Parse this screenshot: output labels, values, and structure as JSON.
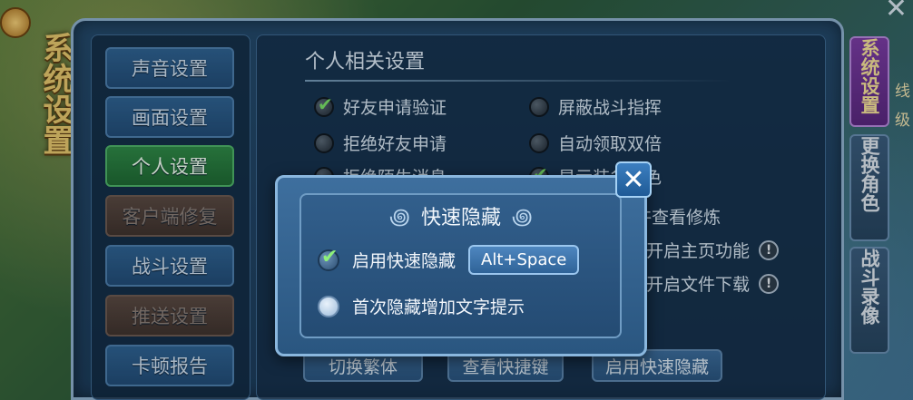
{
  "left_title": "系统设置",
  "nav": {
    "items": [
      {
        "label": "声音设置",
        "state": "normal"
      },
      {
        "label": "画面设置",
        "state": "normal"
      },
      {
        "label": "个人设置",
        "state": "active"
      },
      {
        "label": "客户端修复",
        "state": "dim"
      },
      {
        "label": "战斗设置",
        "state": "normal"
      },
      {
        "label": "推送设置",
        "state": "dim"
      },
      {
        "label": "卡顿报告",
        "state": "normal"
      }
    ]
  },
  "content": {
    "section_title": "个人相关设置",
    "options_left": [
      {
        "label": "好友申请验证",
        "checked": true
      },
      {
        "label": "拒绝好友申请",
        "checked": false
      },
      {
        "label": "拒绝陌生消息",
        "checked": false
      }
    ],
    "options_right": [
      {
        "label": "屏蔽战斗指挥",
        "checked": false
      },
      {
        "label": "自动领取双倍",
        "checked": false
      },
      {
        "label": "显示装备角色",
        "checked": true
      }
    ],
    "right_partial": [
      {
        "label": "允许查看修炼"
      },
      {
        "label": "开启主页功能"
      },
      {
        "label": "开启文件下载"
      }
    ],
    "bottom_buttons": [
      "切换繁体",
      "查看快捷键",
      "启用快速隐藏"
    ]
  },
  "side_tabs": [
    {
      "label": "系统设置",
      "state": "active"
    },
    {
      "label": "更换角色",
      "state": "normal"
    },
    {
      "label": "战斗录像",
      "state": "normal"
    }
  ],
  "edge_text": [
    "线",
    "级"
  ],
  "dialog": {
    "title": "快速隐藏",
    "close_symbol": "✕",
    "enable_label": "启用快速隐藏",
    "enable_checked": true,
    "hotkey": "Alt+Space",
    "tip_label": "首次隐藏增加文字提示",
    "tip_checked": false
  },
  "colors": {
    "nav_active": "#2f8a48",
    "nav_normal": "#2f6393",
    "side_tab_active": "#7b3da5",
    "dialog_bg": "#325f8c",
    "title_gold": "#e7c86e"
  }
}
